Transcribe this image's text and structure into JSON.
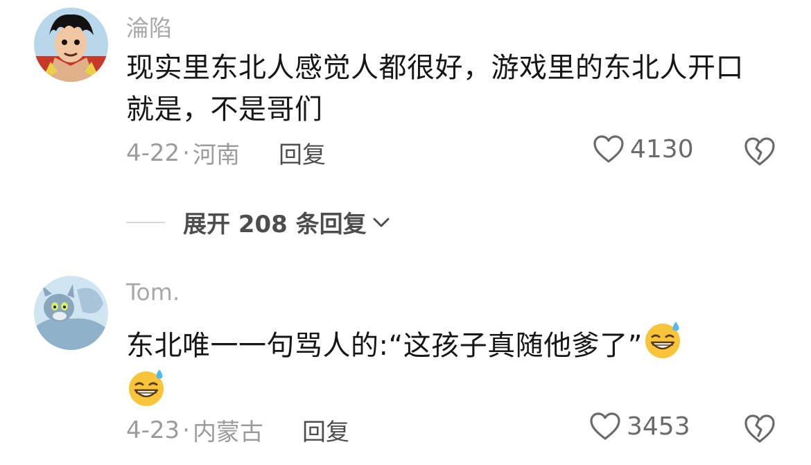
{
  "comments": [
    {
      "username": "淪陷",
      "text": "现实里东北人感觉人都很好，游戏里的东北人开口就是，不是哥们",
      "date": "4-22",
      "location": "河南",
      "reply_label": "回复",
      "likes": "4130"
    },
    {
      "username": "Tom.",
      "text": "东北唯一一句骂人的:“这孩子真随他爹了”",
      "date": "4-23",
      "location": "内蒙古",
      "reply_label": "回复",
      "likes": "3453"
    }
  ],
  "expand": {
    "label": "展开 208 条回复"
  },
  "separator": "·",
  "colors": {
    "username": "#a8a8a8",
    "meta": "#9b9b9b",
    "text": "#161616",
    "icon": "#6a6a6a"
  },
  "icons": [
    "avatar-luffy",
    "avatar-tom",
    "heart-outline-icon",
    "broken-heart-icon",
    "chevron-down-icon",
    "grinning-sweat-emoji"
  ]
}
